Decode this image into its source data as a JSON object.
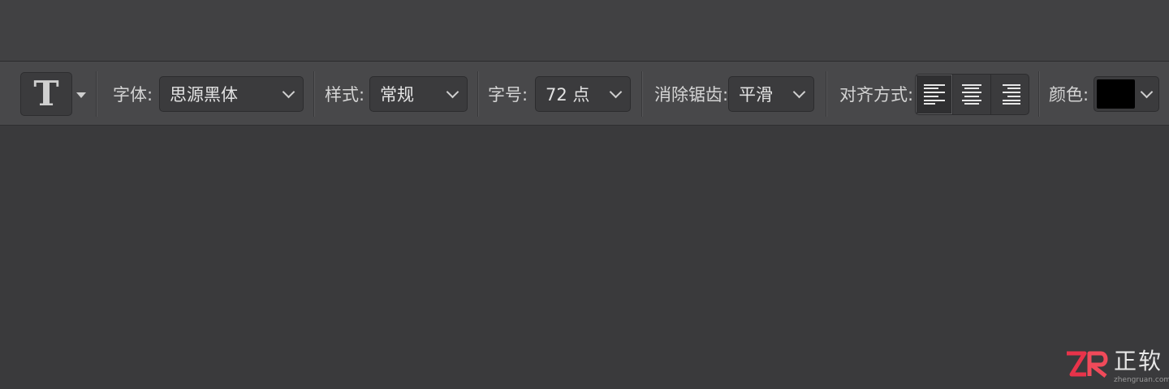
{
  "options_bar": {
    "tool_icon": "type-tool-icon",
    "tool_glyph": "T",
    "font_family": {
      "label": "字体:",
      "value": "思源黑体"
    },
    "font_style": {
      "label": "样式:",
      "value": "常规"
    },
    "font_size": {
      "label": "字号:",
      "value": "72 点"
    },
    "anti_alias": {
      "label": "消除锯齿:",
      "value": "平滑"
    },
    "alignment": {
      "label": "对齐方式:",
      "options": [
        "align-left",
        "align-center",
        "align-right"
      ],
      "selected": "align-left"
    },
    "color": {
      "label": "颜色:",
      "swatch": "#000000"
    }
  },
  "watermark": {
    "logo": "ZR",
    "name": "正软",
    "url": "zhengruan.com"
  },
  "colors": {
    "bar_bg": "#48484a",
    "canvas_bg": "#3a3a3c",
    "control_bg": "#3b3b3d",
    "text": "#d4d4d4",
    "logo_red": "#e8334a"
  }
}
